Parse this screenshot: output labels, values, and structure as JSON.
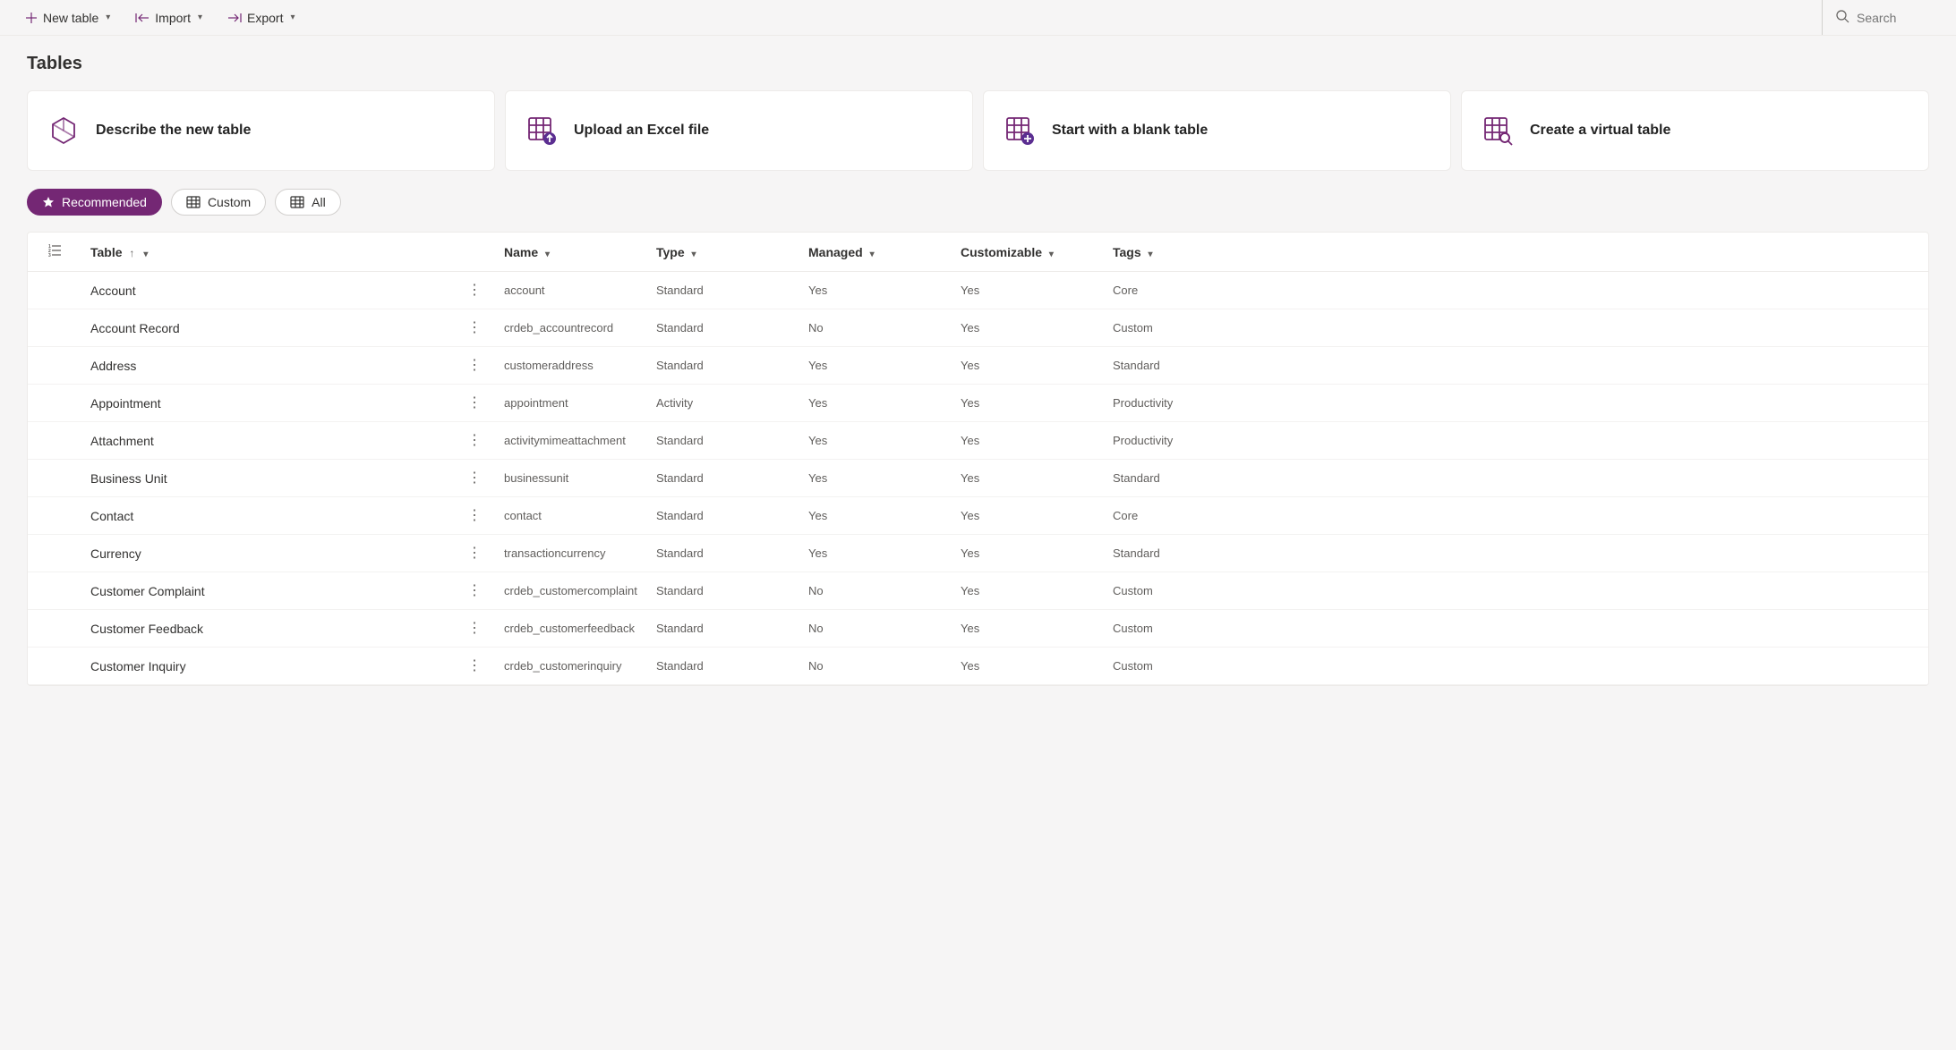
{
  "commandBar": {
    "newTable": "New table",
    "import": "Import",
    "export": "Export",
    "searchPlaceholder": "Search"
  },
  "pageTitle": "Tables",
  "cards": [
    {
      "title": "Describe the new table"
    },
    {
      "title": "Upload an Excel file"
    },
    {
      "title": "Start with a blank table"
    },
    {
      "title": "Create a virtual table"
    }
  ],
  "filters": {
    "recommended": "Recommended",
    "custom": "Custom",
    "all": "All"
  },
  "columns": {
    "table": "Table",
    "name": "Name",
    "type": "Type",
    "managed": "Managed",
    "customizable": "Customizable",
    "tags": "Tags"
  },
  "rows": [
    {
      "display": "Account",
      "name": "account",
      "type": "Standard",
      "managed": "Yes",
      "customizable": "Yes",
      "tags": "Core"
    },
    {
      "display": "Account Record",
      "name": "crdeb_accountrecord",
      "type": "Standard",
      "managed": "No",
      "customizable": "Yes",
      "tags": "Custom"
    },
    {
      "display": "Address",
      "name": "customeraddress",
      "type": "Standard",
      "managed": "Yes",
      "customizable": "Yes",
      "tags": "Standard"
    },
    {
      "display": "Appointment",
      "name": "appointment",
      "type": "Activity",
      "managed": "Yes",
      "customizable": "Yes",
      "tags": "Productivity"
    },
    {
      "display": "Attachment",
      "name": "activitymimeattachment",
      "type": "Standard",
      "managed": "Yes",
      "customizable": "Yes",
      "tags": "Productivity"
    },
    {
      "display": "Business Unit",
      "name": "businessunit",
      "type": "Standard",
      "managed": "Yes",
      "customizable": "Yes",
      "tags": "Standard"
    },
    {
      "display": "Contact",
      "name": "contact",
      "type": "Standard",
      "managed": "Yes",
      "customizable": "Yes",
      "tags": "Core"
    },
    {
      "display": "Currency",
      "name": "transactioncurrency",
      "type": "Standard",
      "managed": "Yes",
      "customizable": "Yes",
      "tags": "Standard"
    },
    {
      "display": "Customer Complaint",
      "name": "crdeb_customercomplaint",
      "type": "Standard",
      "managed": "No",
      "customizable": "Yes",
      "tags": "Custom"
    },
    {
      "display": "Customer Feedback",
      "name": "crdeb_customerfeedback",
      "type": "Standard",
      "managed": "No",
      "customizable": "Yes",
      "tags": "Custom"
    },
    {
      "display": "Customer Inquiry",
      "name": "crdeb_customerinquiry",
      "type": "Standard",
      "managed": "No",
      "customizable": "Yes",
      "tags": "Custom"
    }
  ]
}
